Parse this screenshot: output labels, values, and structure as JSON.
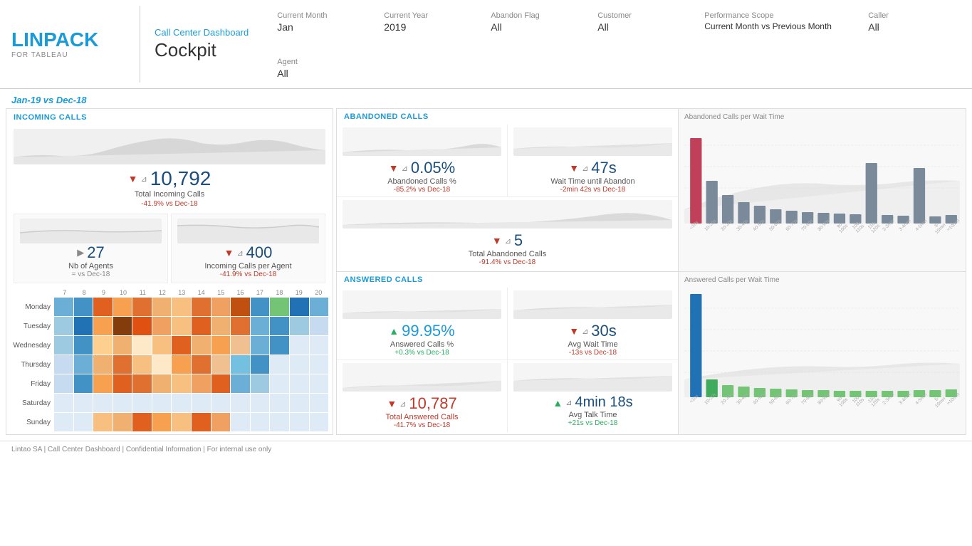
{
  "header": {
    "logo": "LINPACK",
    "logo_color": "LIN",
    "logo_rest": "PACK",
    "logo_sub": "FOR TABLEAU",
    "dashboard_label": "Call Center Dashboard",
    "dashboard_title": "Cockpit"
  },
  "filters": {
    "current_month_label": "Current Month",
    "current_month_value": "Jan",
    "current_year_label": "Current Year",
    "current_year_value": "2019",
    "abandon_flag_label": "Abandon Flag",
    "abandon_flag_value": "All",
    "customer_label": "Customer",
    "customer_value": "All",
    "performance_scope_label": "Performance Scope",
    "performance_scope_value": "Current Month vs Previous Month",
    "caller_label": "Caller",
    "caller_value": "All",
    "agent_label": "Agent",
    "agent_value": "All"
  },
  "period": "Jan-19 vs Dec-18",
  "incoming": {
    "title": "INCOMING CALLS",
    "total_calls_num": "10,792",
    "total_calls_label": "Total Incoming Calls",
    "total_calls_vs": "-41.9% vs Dec-18",
    "agents_num": "27",
    "agents_label": "Nb of Agents",
    "agents_vs": "= vs Dec-18",
    "per_agent_num": "400",
    "per_agent_label": "Incoming Calls per Agent",
    "per_agent_vs": "-41.9% vs Dec-18",
    "days": [
      "Monday",
      "Tuesday",
      "Wednesday",
      "Thursday",
      "Friday",
      "Saturday",
      "Sunday"
    ],
    "hours": [
      "7",
      "8",
      "9",
      "10",
      "11",
      "12",
      "13",
      "14",
      "15",
      "16",
      "17",
      "18",
      "19",
      "20"
    ]
  },
  "abandoned": {
    "title": "ABANDONED CALLS",
    "pct_num": "0.05%",
    "pct_label": "Abandoned Calls %",
    "pct_vs": "-85.2% vs Dec-18",
    "wait_num": "47s",
    "wait_label": "Wait Time until Abandon",
    "wait_vs": "-2min 42s vs Dec-18",
    "total_num": "5",
    "total_label": "Total Abandoned Calls",
    "total_vs": "-91.4% vs Dec-18",
    "chart_title": "Abandoned Calls per Wait Time",
    "bar_labels": [
      "<10s",
      "10-20s",
      "20-30s",
      "30-40s",
      "40-50s",
      "50-60s",
      "60-70s",
      "70-80s",
      "80-90s",
      "90-100s",
      "100-110s",
      "110-120s",
      "2-3min",
      "3-4min",
      "4-5min",
      "5-10min",
      ">10min"
    ]
  },
  "answered": {
    "title": "ANSWERED CALLS",
    "pct_num": "99.95%",
    "pct_label": "Answered Calls %",
    "pct_vs": "+0.3% vs Dec-18",
    "avg_wait_num": "30s",
    "avg_wait_label": "Avg Wait Time",
    "avg_wait_vs": "-13s vs Dec-18",
    "total_num": "10,787",
    "total_label": "Total Answered Calls",
    "total_vs": "-41.7% vs Dec-18",
    "avg_talk_num": "4min 18s",
    "avg_talk_label": "Avg Talk Time",
    "avg_talk_vs": "+21s vs Dec-18",
    "chart_title": "Answered Calls per Wait Time",
    "bar_labels": [
      "<10s",
      "10-20s",
      "20-30s",
      "30-40s",
      "40-50s",
      "50-60s",
      "60-70s",
      "70-80s",
      "80-90s",
      "90-100s",
      "100-110s",
      "110-120s",
      "2-3min",
      "3-4min",
      "4-5min",
      "5-10min",
      ">10min"
    ]
  },
  "footer": "Lintao SA | Call Center Dashboard | Confidential Information | For internal use only"
}
